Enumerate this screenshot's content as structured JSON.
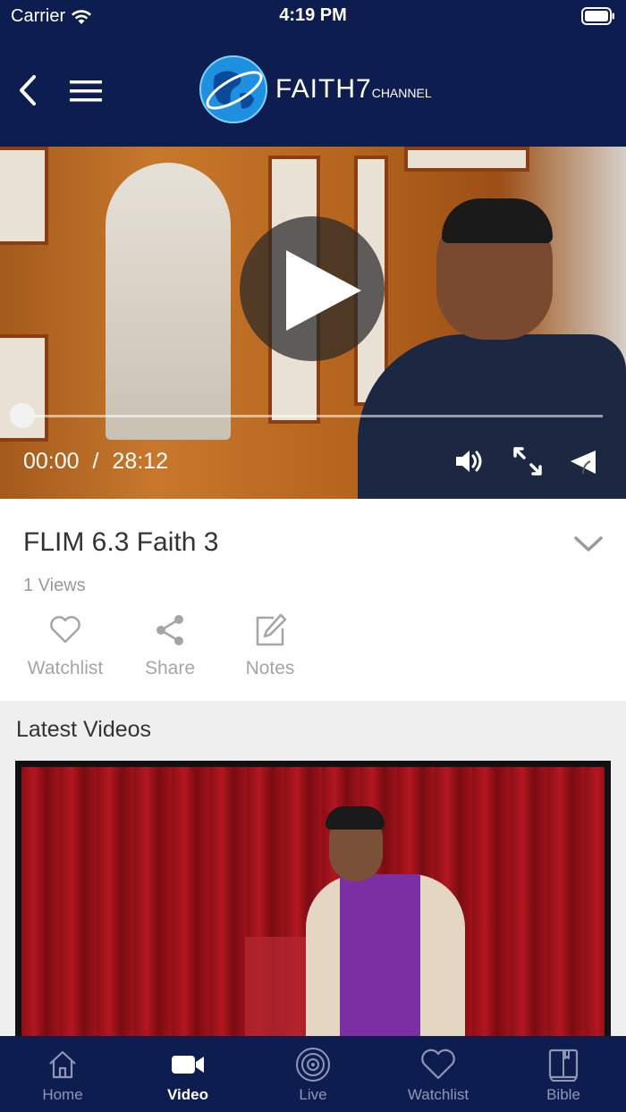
{
  "status": {
    "carrier": "Carrier",
    "time": "4:19 PM"
  },
  "header": {
    "logo_main": "FAITH7",
    "logo_sub": "CHANNEL"
  },
  "player": {
    "current_time": "00:00",
    "separator": "/",
    "duration": "28:12",
    "progress": 0
  },
  "video": {
    "title": "FLIM 6.3 Faith 3",
    "views": "1 Views"
  },
  "actions": [
    {
      "label": "Watchlist",
      "icon": "heart-icon"
    },
    {
      "label": "Share",
      "icon": "share-icon"
    },
    {
      "label": "Notes",
      "icon": "edit-icon"
    }
  ],
  "latest": {
    "title": "Latest Videos"
  },
  "tabs": [
    {
      "label": "Home",
      "icon": "home-icon",
      "active": false
    },
    {
      "label": "Video",
      "icon": "video-camera-icon",
      "active": true
    },
    {
      "label": "Live",
      "icon": "broadcast-icon",
      "active": false
    },
    {
      "label": "Watchlist",
      "icon": "heart-icon",
      "active": false
    },
    {
      "label": "Bible",
      "icon": "book-icon",
      "active": false
    }
  ],
  "colors": {
    "navy": "#0e1d4f",
    "muted": "#a5a5a5",
    "inactive_tab": "#8f97b3"
  }
}
